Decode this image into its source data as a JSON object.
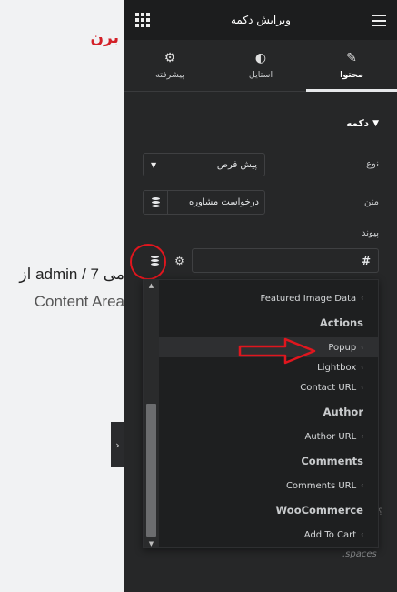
{
  "preview": {
    "brand_text": "برن",
    "meta_text": "از admin / 7 می",
    "content_area": "Content Area",
    "collapse_glyph": "›"
  },
  "panel": {
    "title": "ویرایش دکمه",
    "tabs": [
      {
        "label": "محتوا",
        "icon": "pencil-icon",
        "glyph": "✎"
      },
      {
        "label": "استایل",
        "icon": "half-circle-icon",
        "glyph": "◐"
      },
      {
        "label": "پیشرفته",
        "icon": "gear-icon",
        "glyph": "⚙"
      }
    ],
    "section_title": "دکمه",
    "type_label": "نوع",
    "type_value": "پیش فرض",
    "text_label": "متن",
    "text_value": "درخواست مشاوره",
    "link_label": "پیوند",
    "link_value": "#",
    "faded_mini": "؟",
    "faded_label": ".spaces"
  },
  "dropdown": {
    "items": [
      {
        "kind": "item",
        "label": "Featured Image Data"
      },
      {
        "kind": "group",
        "label": "Actions"
      },
      {
        "kind": "item",
        "label": "Popup",
        "highlighted": true
      },
      {
        "kind": "item",
        "label": "Lightbox"
      },
      {
        "kind": "item",
        "label": "Contact URL"
      },
      {
        "kind": "group",
        "label": "Author"
      },
      {
        "kind": "item",
        "label": "Author URL"
      },
      {
        "kind": "group",
        "label": "Comments"
      },
      {
        "kind": "item",
        "label": "Comments URL"
      },
      {
        "kind": "group",
        "label": "WooCommerce"
      },
      {
        "kind": "item",
        "label": "Add To Cart"
      }
    ]
  },
  "colors": {
    "panel_bg": "#262728",
    "header_bg": "#1c1d1e",
    "annotation_red": "#e0161e",
    "brand_red": "#d32027"
  }
}
